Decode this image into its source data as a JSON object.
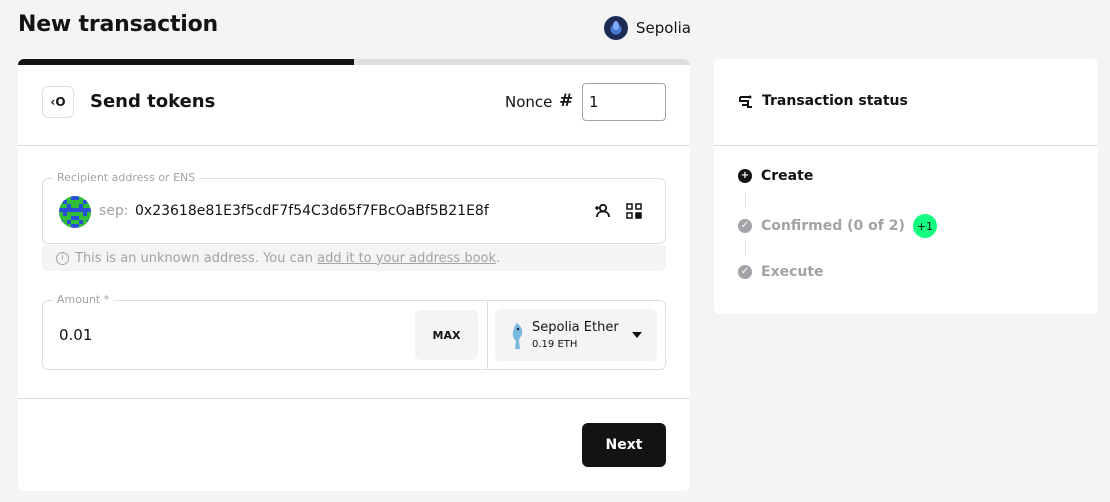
{
  "page": {
    "title": "New transaction"
  },
  "network": {
    "name": "Sepolia"
  },
  "progress": {
    "fraction": 0.5
  },
  "tx_card": {
    "icon_label": "‹O",
    "title": "Send tokens",
    "nonce_label": "Nonce",
    "nonce_hash": "#",
    "nonce_value": "1"
  },
  "recipient": {
    "legend": "Recipient address or ENS",
    "prefix": "sep:",
    "address": "0x23618e81E3f5cdF7f54C3d65f7FBcOaBf5B21E8f",
    "unknown_text": "This is an unknown address. You can ",
    "unknown_link": "add it to your address book",
    "unknown_end": "."
  },
  "amount": {
    "legend": "Amount *",
    "value": "0.01",
    "max_label": "MAX",
    "token_name": "Sepolia Ether",
    "token_balance": "0.19 ETH"
  },
  "actions": {
    "next_label": "Next"
  },
  "status": {
    "title": "Transaction status",
    "steps": [
      {
        "label": "Create",
        "state": "done"
      },
      {
        "label": "Confirmed (0 of 2)",
        "state": "pending",
        "badge": "+1"
      },
      {
        "label": "Execute",
        "state": "pending"
      }
    ]
  },
  "colors": {
    "accent": "#12ff80",
    "text": "#121312",
    "muted": "#a1a3a7",
    "border": "#dcdee0",
    "background": "#f4f4f4"
  },
  "icons": {
    "tx_type": "send-tokens-icon",
    "add_to_address_book": "add-contact-icon",
    "scan_qr": "qr-code-icon",
    "status": "transaction-status-icon",
    "info": "info-icon",
    "step_done": "plus-circle-icon",
    "step_pending": "check-circle-icon",
    "token_dropdown": "caret-down-icon"
  }
}
